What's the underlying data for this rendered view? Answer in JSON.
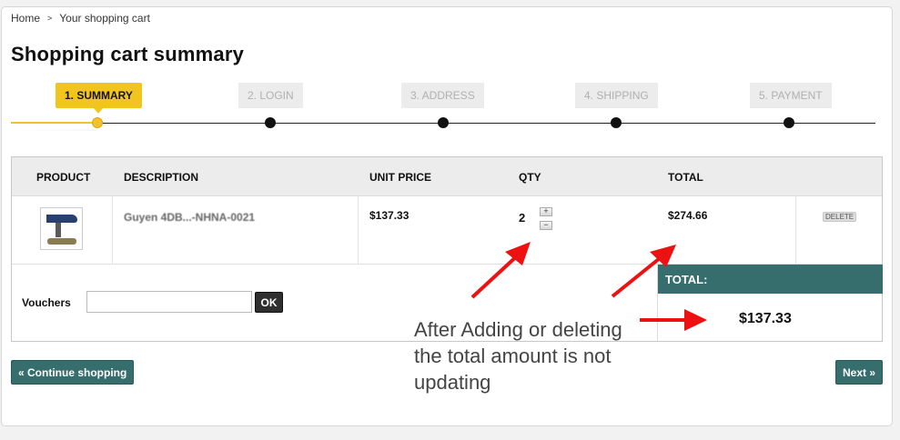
{
  "breadcrumb": {
    "home": "Home",
    "separator": ">",
    "current": "Your shopping cart"
  },
  "page_title": "Shopping cart summary",
  "steps": [
    {
      "label": "1. SUMMARY",
      "active": true
    },
    {
      "label": "2. LOGIN",
      "active": false
    },
    {
      "label": "3. ADDRESS",
      "active": false
    },
    {
      "label": "4. SHIPPING",
      "active": false
    },
    {
      "label": "5. PAYMENT",
      "active": false
    }
  ],
  "table": {
    "headers": {
      "product": "PRODUCT",
      "description": "DESCRIPTION",
      "unit_price": "UNIT PRICE",
      "qty": "QTY",
      "total": "TOTAL"
    },
    "rows": [
      {
        "description": "Guyen 4DB...-NHNA-0021",
        "unit_price": "$137.33",
        "qty": "2",
        "qty_plus": "+",
        "qty_minus": "−",
        "total": "$274.66",
        "delete": "DELETE"
      }
    ]
  },
  "vouchers": {
    "label": "Vouchers",
    "value": "",
    "ok": "OK"
  },
  "summary": {
    "total_label": "TOTAL:",
    "total_value": "$137.33"
  },
  "buttons": {
    "continue": "« Continue shopping",
    "next": "Next »"
  },
  "annotation": {
    "line1": "After Adding or deleting",
    "line2": "the total amount is not",
    "line3": "updating"
  },
  "colors": {
    "accent": "#f2c51e",
    "teal": "#356e6d",
    "arrow": "#ee1111"
  }
}
